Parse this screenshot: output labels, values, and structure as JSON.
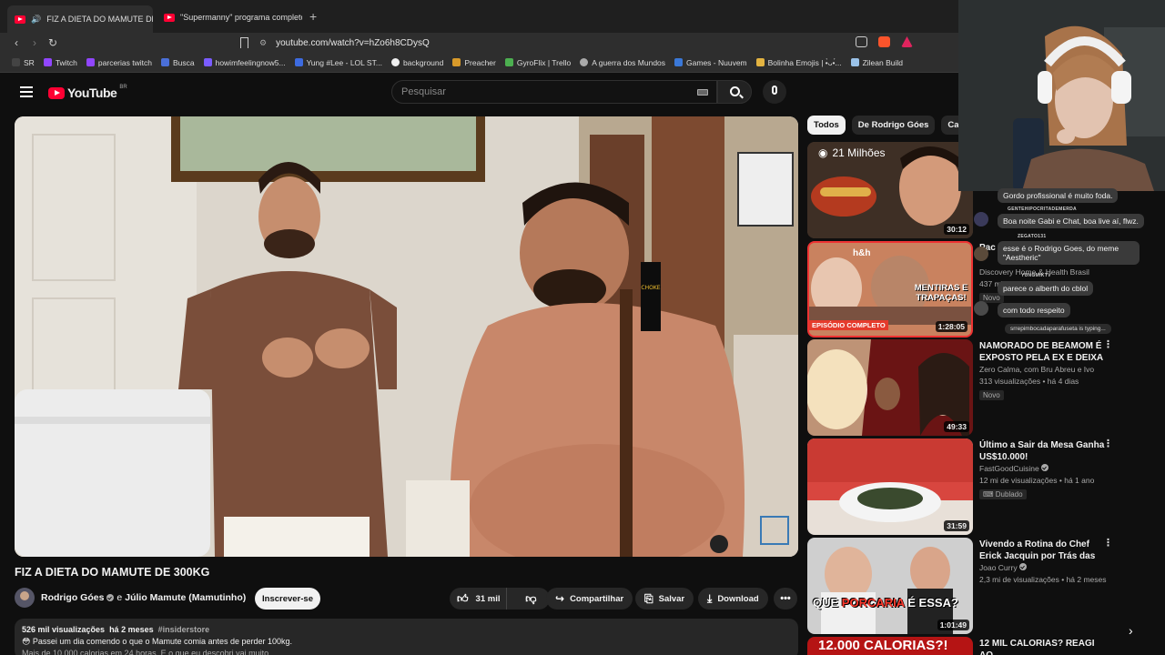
{
  "browser": {
    "tabs": [
      {
        "label": "FIZ A DIETA DO MAMUTE DE",
        "active": true
      },
      {
        "label": "\"Supermanny\" programa completo -",
        "active": false
      }
    ],
    "url": "youtube.com/watch?v=hZo6h8CDysQ",
    "bookmarks": [
      {
        "label": "SR",
        "color": "#2b2b2b"
      },
      {
        "label": "Twitch",
        "color": "#9146ff"
      },
      {
        "label": "parcerias twitch",
        "color": "#9146ff"
      },
      {
        "label": "Busca",
        "color": "#4a6fd8"
      },
      {
        "label": "howimfeelingnow5...",
        "color": "#7a5cff"
      },
      {
        "label": "Yung #Lee - LOL ST...",
        "color": "#3d6be0"
      },
      {
        "label": "background",
        "color": "#f0f0f0"
      },
      {
        "label": "Preacher",
        "color": "#d89a2a"
      },
      {
        "label": "GyroFlix | Trello",
        "color": "#4caf50"
      },
      {
        "label": "A guerra dos Mundos",
        "color": "#aaaaaa"
      },
      {
        "label": "Games - Nuuvem",
        "color": "#3a78d8"
      },
      {
        "label": "Bolinha Emojis | •̀ᴗ•́...",
        "color": "#e3b341"
      },
      {
        "label": "Zilean Build",
        "color": "#9ac2e8"
      }
    ]
  },
  "youtube": {
    "logo_text": "YouTube",
    "country": "BR",
    "search_placeholder": "Pesquisar"
  },
  "video": {
    "title": "FIZ A DIETA DO MAMUTE DE 300KG",
    "channel": "Rodrigo Góes",
    "joiner": "e",
    "collaborator": "Júlio Mamute (Mamutinho)",
    "subscribe": "Inscrever-se",
    "likes": "31 mil",
    "share": "Compartilhar",
    "save": "Salvar",
    "download": "Download",
    "views": "526 mil visualizações",
    "age": "há 2 meses",
    "tag": "#insiderstore",
    "desc_line1": "😳 Passei um dia comendo o que o Mamute comia antes de perder 100kg.",
    "desc_line2": "Mais de 10.000 calorias em 24 horas. E o que eu descobri vai muito",
    "overlay_can": "CHOKE"
  },
  "sidebar": {
    "chips": [
      "Todos",
      "De Rodrigo Góes",
      "Calo"
    ],
    "recs": [
      {
        "title": "",
        "duration": "30:12",
        "overlay": "21 Milhões",
        "meta": []
      },
      {
        "title": "Pac",
        "duration": "1:28:05",
        "overlay": "MENTIRAS E TRAPAÇAS!",
        "banner": "EPISÓDIO COMPLETO",
        "brand": "h&h",
        "meta": [
          "Discovery Home & Health Brasil",
          "437 mil"
        ],
        "badge": "Novo"
      },
      {
        "title": "NAMORADO DE BEAMOM É EXPOSTO PELA EX E DEIXA ...",
        "duration": "49:33",
        "meta": [
          "Zero Calma, com Bru Abreu e Ivo",
          "313 visualizações • há 4 dias"
        ],
        "badge": "Novo"
      },
      {
        "title": "Último a Sair da Mesa Ganha US$10.000!",
        "duration": "31:59",
        "meta": [
          "FastGoodCuisine",
          "12 mi de visualizações • há 1 ano"
        ],
        "badge": "Dublado"
      },
      {
        "title": "Vivendo a Rotina do Chef Erick Jacquin por Trás das Câmera...",
        "duration": "1:01:49",
        "overlay": "QUE PORCARIA É ESSA?",
        "overlay_hl": "PORCARIA",
        "meta": [
          "Joao Curry",
          "2,3 mi de visualizações • há 2 meses"
        ]
      },
      {
        "title": "12 MIL CALORIAS? REAGI AO",
        "overlay": "12.000 CALORIAS?!",
        "meta": []
      }
    ]
  },
  "chat": {
    "messages": [
      {
        "name": "",
        "text": "Gordo profissional é muito foda."
      },
      {
        "name": "GENTEHIPOCRITADEMERDA",
        "text": "Boa noite Gabi e Chat, boa live aí, flwz."
      },
      {
        "name": "ZEGATO131",
        "text": "esse é o Rodrigo Goes, do meme \"Aestheric\""
      },
      {
        "name": "YUNGMIKTV",
        "text": "parece o alberth do cblol"
      },
      {
        "name": "",
        "text": "com todo respeito"
      }
    ],
    "typing": "srrepimbocadaparafuseta is typing..."
  }
}
